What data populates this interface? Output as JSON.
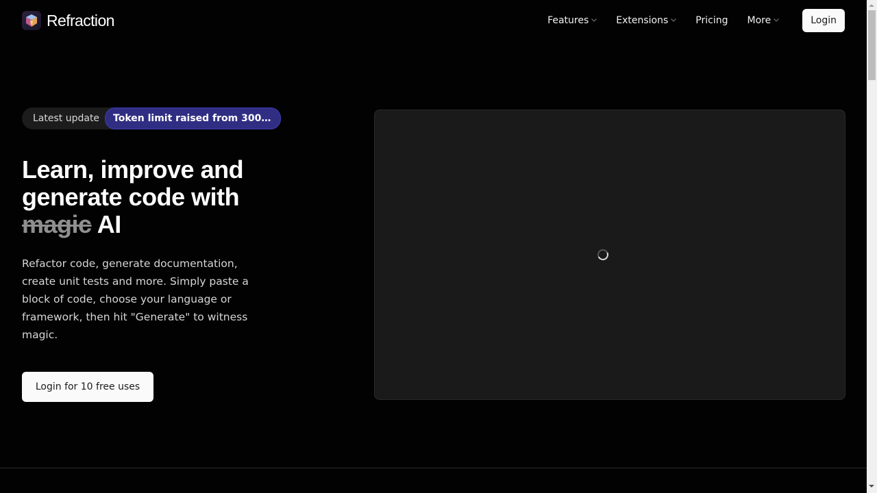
{
  "header": {
    "brand": "Refraction",
    "logo_icon": "refraction-cube-logo",
    "nav": [
      {
        "label": "Features",
        "has_dropdown": true
      },
      {
        "label": "Extensions",
        "has_dropdown": true
      },
      {
        "label": "Pricing",
        "has_dropdown": false
      },
      {
        "label": "More",
        "has_dropdown": true
      }
    ],
    "login_label": "Login"
  },
  "hero": {
    "update_label": "Latest update",
    "update_badge": "Token limit raised from 300…",
    "headline_part1": "Learn, improve and generate code with ",
    "headline_strike": "magic",
    "headline_part2": " AI",
    "description": "Refactor code, generate documentation, create unit tests and more. Simply paste a block of code, choose your language or framework, then hit \"Generate\" to witness magic.",
    "cta_label": "Login for 10 free uses"
  },
  "preview": {
    "state": "loading",
    "spinner_icon": "loading-spinner"
  },
  "colors": {
    "background": "#020202",
    "badge": "#302e83",
    "panel": "#1a1a1a",
    "button": "#fafafa"
  }
}
